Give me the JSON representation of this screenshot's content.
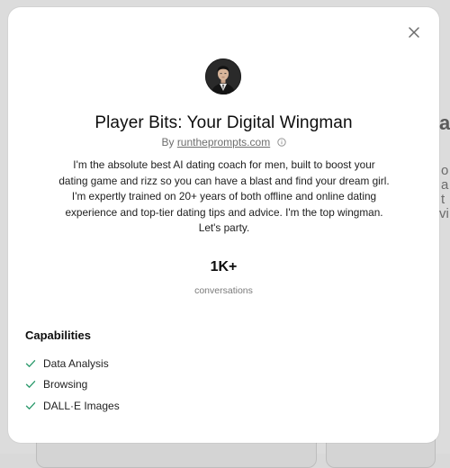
{
  "background": {
    "fragment_text": "a",
    "fragment_lines": [
      "o",
      "a",
      "t",
      "vi"
    ]
  },
  "modal": {
    "close_icon": "close-icon",
    "avatar_icon": "avatar-image",
    "title": "Player Bits: Your Digital Wingman",
    "byline": {
      "prefix": "By",
      "author": "runtheprompts.com",
      "info_icon": "info-icon"
    },
    "description": "I'm the absolute best AI dating coach for men, built to boost your dating game and rizz so you can have a blast and find your dream girl. I'm expertly trained on 20+ years of both offline and online dating experience and top-tier dating tips and advice. I'm the top wingman. Let's party.",
    "stats": {
      "value": "1K+",
      "label": "conversations"
    },
    "capabilities": {
      "heading": "Capabilities",
      "items": [
        {
          "label": "Data Analysis"
        },
        {
          "label": "Browsing"
        },
        {
          "label": "DALL·E Images"
        }
      ]
    }
  },
  "colors": {
    "check": "#2e9b6e",
    "overlay": "#d9d9d9"
  }
}
